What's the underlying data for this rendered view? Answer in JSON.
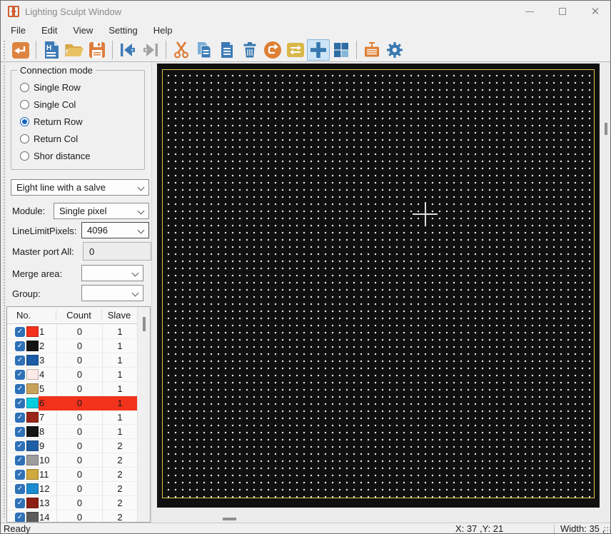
{
  "window": {
    "title": "Lighting Sculpt Window"
  },
  "titlebar_controls": {
    "minimize": "minimize",
    "maximize": "maximize",
    "close": "close"
  },
  "menu": {
    "items": [
      "File",
      "Edit",
      "View",
      "Setting",
      "Help"
    ]
  },
  "toolbar": {
    "icons": [
      "return",
      "new-file-h",
      "open-folder",
      "save",
      "go-first",
      "go-last",
      "cut",
      "copy",
      "paste",
      "delete",
      "redo-loop",
      "swap",
      "crosshair",
      "grid-blocks",
      "output-device",
      "settings"
    ],
    "selected_icon": "crosshair",
    "disabled_icon": "go-last"
  },
  "panel": {
    "connection_mode": {
      "legend": "Connection mode",
      "options": [
        {
          "label": "Single Row",
          "selected": false
        },
        {
          "label": "Single Col",
          "selected": false
        },
        {
          "label": "Return Row",
          "selected": true
        },
        {
          "label": "Return Col",
          "selected": false
        },
        {
          "label": "Shor distance",
          "selected": false
        }
      ]
    },
    "wiring_combo": {
      "value": "Eight line with a salve"
    },
    "module": {
      "label": "Module:",
      "value": "Single pixel"
    },
    "line_limit": {
      "label": "LineLimitPixels:",
      "value": "4096"
    },
    "master_port": {
      "label": "Master port All:",
      "value": "0"
    },
    "merge_area": {
      "label": "Merge area:",
      "value": ""
    },
    "group": {
      "label": "Group:",
      "value": ""
    },
    "table": {
      "columns": [
        "No.",
        "Count",
        "Slave"
      ],
      "rows": [
        {
          "no": "1",
          "color": "#f5301d",
          "count": "0",
          "slave": "1",
          "checked": true,
          "highlighted": false
        },
        {
          "no": "2",
          "color": "#141414",
          "count": "0",
          "slave": "1",
          "checked": true,
          "highlighted": false
        },
        {
          "no": "3",
          "color": "#1b5ca4",
          "count": "0",
          "slave": "1",
          "checked": true,
          "highlighted": false
        },
        {
          "no": "4",
          "color": "#fceae8",
          "count": "0",
          "slave": "1",
          "checked": true,
          "highlighted": false
        },
        {
          "no": "5",
          "color": "#c7a258",
          "count": "0",
          "slave": "1",
          "checked": true,
          "highlighted": false
        },
        {
          "no": "6",
          "color": "#06cede",
          "count": "0",
          "slave": "1",
          "checked": true,
          "highlighted": true
        },
        {
          "no": "7",
          "color": "#99241a",
          "count": "0",
          "slave": "1",
          "checked": true,
          "highlighted": false
        },
        {
          "no": "8",
          "color": "#141414",
          "count": "0",
          "slave": "1",
          "checked": true,
          "highlighted": false
        },
        {
          "no": "9",
          "color": "#1f5fa6",
          "count": "0",
          "slave": "2",
          "checked": true,
          "highlighted": false
        },
        {
          "no": "10",
          "color": "#9d9d9d",
          "count": "0",
          "slave": "2",
          "checked": true,
          "highlighted": false
        },
        {
          "no": "11",
          "color": "#cfa83e",
          "count": "0",
          "slave": "2",
          "checked": true,
          "highlighted": false
        },
        {
          "no": "12",
          "color": "#1b8bd0",
          "count": "0",
          "slave": "2",
          "checked": true,
          "highlighted": false
        },
        {
          "no": "13",
          "color": "#8e1f15",
          "count": "0",
          "slave": "2",
          "checked": true,
          "highlighted": false
        },
        {
          "no": "14",
          "color": "#5c5c5c",
          "count": "0",
          "slave": "2",
          "checked": true,
          "highlighted": false
        }
      ]
    }
  },
  "canvas": {
    "background": "#101010",
    "border_color": "#e3c84e",
    "dot_color": "#eeeeee",
    "highlight_row_color": "#f3321c"
  },
  "status": {
    "ready": "Ready",
    "coords": "X: 37 ,Y: 21",
    "width_info": "Width: 35 ,"
  }
}
